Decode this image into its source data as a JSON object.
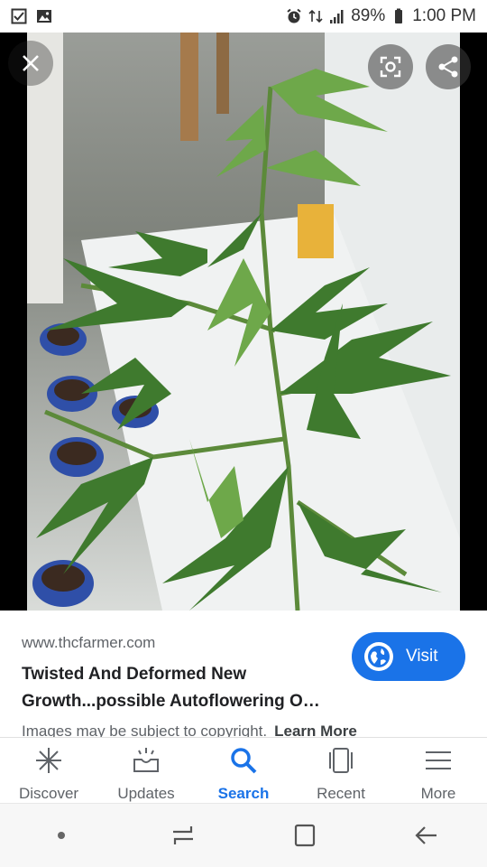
{
  "status_bar": {
    "battery": "89%",
    "time": "1:00 PM",
    "left_icons": [
      "checkbox-notification-icon",
      "gallery-notification-icon"
    ],
    "right_icons": [
      "alarm-icon",
      "data-icon",
      "signal-icon"
    ]
  },
  "viewer": {
    "close_icon": "close-icon",
    "lens_icon": "lens-icon",
    "share_icon": "share-icon"
  },
  "result": {
    "domain": "www.thcfarmer.com",
    "title_line1": "Twisted And Deformed New",
    "title_line2": "Growth...possible Autoflowering O…",
    "visit_label": "Visit",
    "copyright": "Images may be subject to copyright.",
    "learn_more": "Learn More"
  },
  "bottom_nav": {
    "items": [
      {
        "label": "Discover",
        "icon": "asterisk-icon"
      },
      {
        "label": "Updates",
        "icon": "updates-icon"
      },
      {
        "label": "Search",
        "icon": "search-icon",
        "active": true
      },
      {
        "label": "Recent",
        "icon": "recent-icon"
      },
      {
        "label": "More",
        "icon": "menu-icon"
      }
    ]
  },
  "colors": {
    "accent": "#1a73e8",
    "text_secondary": "#5f6368"
  }
}
